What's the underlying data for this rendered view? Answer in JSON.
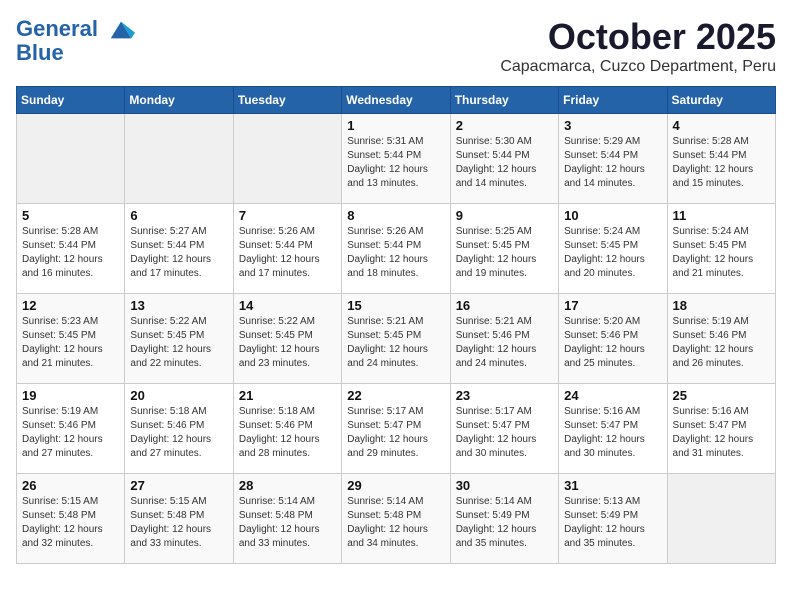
{
  "header": {
    "logo_line1": "General",
    "logo_line2": "Blue",
    "month": "October 2025",
    "location": "Capacmarca, Cuzco Department, Peru"
  },
  "weekdays": [
    "Sunday",
    "Monday",
    "Tuesday",
    "Wednesday",
    "Thursday",
    "Friday",
    "Saturday"
  ],
  "weeks": [
    [
      {
        "day": "",
        "sunrise": "",
        "sunset": "",
        "daylight": ""
      },
      {
        "day": "",
        "sunrise": "",
        "sunset": "",
        "daylight": ""
      },
      {
        "day": "",
        "sunrise": "",
        "sunset": "",
        "daylight": ""
      },
      {
        "day": "1",
        "sunrise": "Sunrise: 5:31 AM",
        "sunset": "Sunset: 5:44 PM",
        "daylight": "Daylight: 12 hours and 13 minutes."
      },
      {
        "day": "2",
        "sunrise": "Sunrise: 5:30 AM",
        "sunset": "Sunset: 5:44 PM",
        "daylight": "Daylight: 12 hours and 14 minutes."
      },
      {
        "day": "3",
        "sunrise": "Sunrise: 5:29 AM",
        "sunset": "Sunset: 5:44 PM",
        "daylight": "Daylight: 12 hours and 14 minutes."
      },
      {
        "day": "4",
        "sunrise": "Sunrise: 5:28 AM",
        "sunset": "Sunset: 5:44 PM",
        "daylight": "Daylight: 12 hours and 15 minutes."
      }
    ],
    [
      {
        "day": "5",
        "sunrise": "Sunrise: 5:28 AM",
        "sunset": "Sunset: 5:44 PM",
        "daylight": "Daylight: 12 hours and 16 minutes."
      },
      {
        "day": "6",
        "sunrise": "Sunrise: 5:27 AM",
        "sunset": "Sunset: 5:44 PM",
        "daylight": "Daylight: 12 hours and 17 minutes."
      },
      {
        "day": "7",
        "sunrise": "Sunrise: 5:26 AM",
        "sunset": "Sunset: 5:44 PM",
        "daylight": "Daylight: 12 hours and 17 minutes."
      },
      {
        "day": "8",
        "sunrise": "Sunrise: 5:26 AM",
        "sunset": "Sunset: 5:44 PM",
        "daylight": "Daylight: 12 hours and 18 minutes."
      },
      {
        "day": "9",
        "sunrise": "Sunrise: 5:25 AM",
        "sunset": "Sunset: 5:45 PM",
        "daylight": "Daylight: 12 hours and 19 minutes."
      },
      {
        "day": "10",
        "sunrise": "Sunrise: 5:24 AM",
        "sunset": "Sunset: 5:45 PM",
        "daylight": "Daylight: 12 hours and 20 minutes."
      },
      {
        "day": "11",
        "sunrise": "Sunrise: 5:24 AM",
        "sunset": "Sunset: 5:45 PM",
        "daylight": "Daylight: 12 hours and 21 minutes."
      }
    ],
    [
      {
        "day": "12",
        "sunrise": "Sunrise: 5:23 AM",
        "sunset": "Sunset: 5:45 PM",
        "daylight": "Daylight: 12 hours and 21 minutes."
      },
      {
        "day": "13",
        "sunrise": "Sunrise: 5:22 AM",
        "sunset": "Sunset: 5:45 PM",
        "daylight": "Daylight: 12 hours and 22 minutes."
      },
      {
        "day": "14",
        "sunrise": "Sunrise: 5:22 AM",
        "sunset": "Sunset: 5:45 PM",
        "daylight": "Daylight: 12 hours and 23 minutes."
      },
      {
        "day": "15",
        "sunrise": "Sunrise: 5:21 AM",
        "sunset": "Sunset: 5:45 PM",
        "daylight": "Daylight: 12 hours and 24 minutes."
      },
      {
        "day": "16",
        "sunrise": "Sunrise: 5:21 AM",
        "sunset": "Sunset: 5:46 PM",
        "daylight": "Daylight: 12 hours and 24 minutes."
      },
      {
        "day": "17",
        "sunrise": "Sunrise: 5:20 AM",
        "sunset": "Sunset: 5:46 PM",
        "daylight": "Daylight: 12 hours and 25 minutes."
      },
      {
        "day": "18",
        "sunrise": "Sunrise: 5:19 AM",
        "sunset": "Sunset: 5:46 PM",
        "daylight": "Daylight: 12 hours and 26 minutes."
      }
    ],
    [
      {
        "day": "19",
        "sunrise": "Sunrise: 5:19 AM",
        "sunset": "Sunset: 5:46 PM",
        "daylight": "Daylight: 12 hours and 27 minutes."
      },
      {
        "day": "20",
        "sunrise": "Sunrise: 5:18 AM",
        "sunset": "Sunset: 5:46 PM",
        "daylight": "Daylight: 12 hours and 27 minutes."
      },
      {
        "day": "21",
        "sunrise": "Sunrise: 5:18 AM",
        "sunset": "Sunset: 5:46 PM",
        "daylight": "Daylight: 12 hours and 28 minutes."
      },
      {
        "day": "22",
        "sunrise": "Sunrise: 5:17 AM",
        "sunset": "Sunset: 5:47 PM",
        "daylight": "Daylight: 12 hours and 29 minutes."
      },
      {
        "day": "23",
        "sunrise": "Sunrise: 5:17 AM",
        "sunset": "Sunset: 5:47 PM",
        "daylight": "Daylight: 12 hours and 30 minutes."
      },
      {
        "day": "24",
        "sunrise": "Sunrise: 5:16 AM",
        "sunset": "Sunset: 5:47 PM",
        "daylight": "Daylight: 12 hours and 30 minutes."
      },
      {
        "day": "25",
        "sunrise": "Sunrise: 5:16 AM",
        "sunset": "Sunset: 5:47 PM",
        "daylight": "Daylight: 12 hours and 31 minutes."
      }
    ],
    [
      {
        "day": "26",
        "sunrise": "Sunrise: 5:15 AM",
        "sunset": "Sunset: 5:48 PM",
        "daylight": "Daylight: 12 hours and 32 minutes."
      },
      {
        "day": "27",
        "sunrise": "Sunrise: 5:15 AM",
        "sunset": "Sunset: 5:48 PM",
        "daylight": "Daylight: 12 hours and 33 minutes."
      },
      {
        "day": "28",
        "sunrise": "Sunrise: 5:14 AM",
        "sunset": "Sunset: 5:48 PM",
        "daylight": "Daylight: 12 hours and 33 minutes."
      },
      {
        "day": "29",
        "sunrise": "Sunrise: 5:14 AM",
        "sunset": "Sunset: 5:48 PM",
        "daylight": "Daylight: 12 hours and 34 minutes."
      },
      {
        "day": "30",
        "sunrise": "Sunrise: 5:14 AM",
        "sunset": "Sunset: 5:49 PM",
        "daylight": "Daylight: 12 hours and 35 minutes."
      },
      {
        "day": "31",
        "sunrise": "Sunrise: 5:13 AM",
        "sunset": "Sunset: 5:49 PM",
        "daylight": "Daylight: 12 hours and 35 minutes."
      },
      {
        "day": "",
        "sunrise": "",
        "sunset": "",
        "daylight": ""
      }
    ]
  ]
}
